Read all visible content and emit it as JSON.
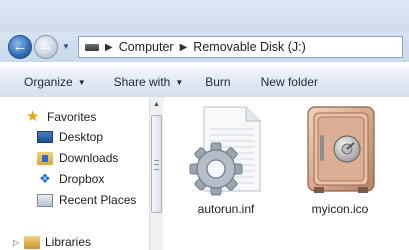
{
  "title_strip": {
    "cut_text": ""
  },
  "navigation": {
    "back_icon": "back-arrow-icon",
    "forward_icon": "forward-arrow-icon"
  },
  "address_bar": {
    "breadcrumb": [
      "Computer",
      "Removable Disk (J:)"
    ]
  },
  "command_bar": {
    "organize": "Organize",
    "share_with": "Share with",
    "burn": "Burn",
    "new_folder": "New folder"
  },
  "nav_pane": {
    "favorites_label": "Favorites",
    "favorites": [
      {
        "label": "Desktop",
        "icon": "desktop-icon"
      },
      {
        "label": "Downloads",
        "icon": "downloads-folder-icon"
      },
      {
        "label": "Dropbox",
        "icon": "dropbox-icon"
      },
      {
        "label": "Recent Places",
        "icon": "recent-places-icon"
      }
    ],
    "libraries_label": "Libraries"
  },
  "files": [
    {
      "name": "autorun.inf",
      "icon": "settings-file-icon"
    },
    {
      "name": "myicon.ico",
      "icon": "safe-icon"
    }
  ],
  "colors": {
    "toolbar_top": "#f5f8fc",
    "toolbar_bottom": "#d5e0ee",
    "accent_blue": "#2f6db7",
    "favorites_star": "#e8a316"
  }
}
